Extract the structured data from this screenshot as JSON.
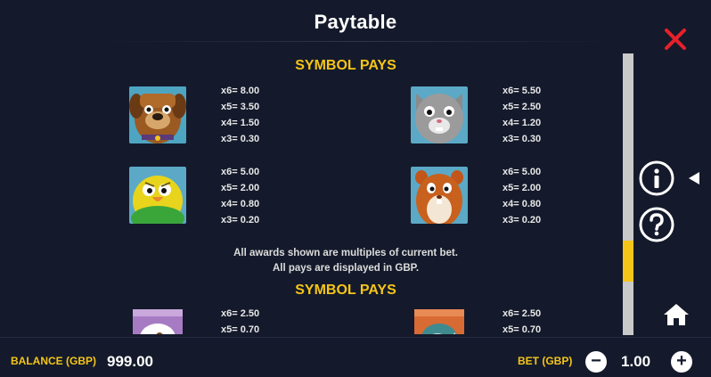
{
  "header": {
    "title": "Paytable"
  },
  "paytable": {
    "section_title": "SYMBOL PAYS",
    "symbols": [
      {
        "name": "dog",
        "odds": [
          "x6= 8.00",
          "x5= 3.50",
          "x4= 1.50",
          "x3= 0.30"
        ]
      },
      {
        "name": "cat",
        "odds": [
          "x6= 5.50",
          "x5= 2.50",
          "x4= 1.20",
          "x3= 0.30"
        ]
      },
      {
        "name": "bird",
        "odds": [
          "x6= 5.00",
          "x5= 2.00",
          "x4= 0.80",
          "x3= 0.20"
        ]
      },
      {
        "name": "hamster",
        "odds": [
          "x6= 5.00",
          "x5= 2.00",
          "x4= 0.80",
          "x3= 0.20"
        ]
      }
    ],
    "notes": [
      "All awards shown are multiples of current bet.",
      "All pays are displayed in GBP."
    ],
    "section2_title": "SYMBOL PAYS",
    "symbols2": [
      {
        "name": "food-bag",
        "odds": [
          "x6= 2.50",
          "x5= 0.70"
        ]
      },
      {
        "name": "fish-bag",
        "odds": [
          "x6= 2.50",
          "x5= 0.70"
        ]
      }
    ]
  },
  "footer": {
    "balance_label": "BALANCE (GBP)",
    "balance_value": "999.00",
    "bet_label": "BET (GBP)",
    "bet_value": "1.00",
    "minus": "−",
    "plus": "+"
  },
  "colors": {
    "accent": "#f5c518",
    "close": "#e8202a",
    "background": "#141a2b"
  },
  "icons": [
    "close-icon",
    "info-icon",
    "help-icon",
    "home-icon",
    "arrow-left-icon"
  ],
  "scrollbar": {
    "position_fraction": 0.72
  }
}
